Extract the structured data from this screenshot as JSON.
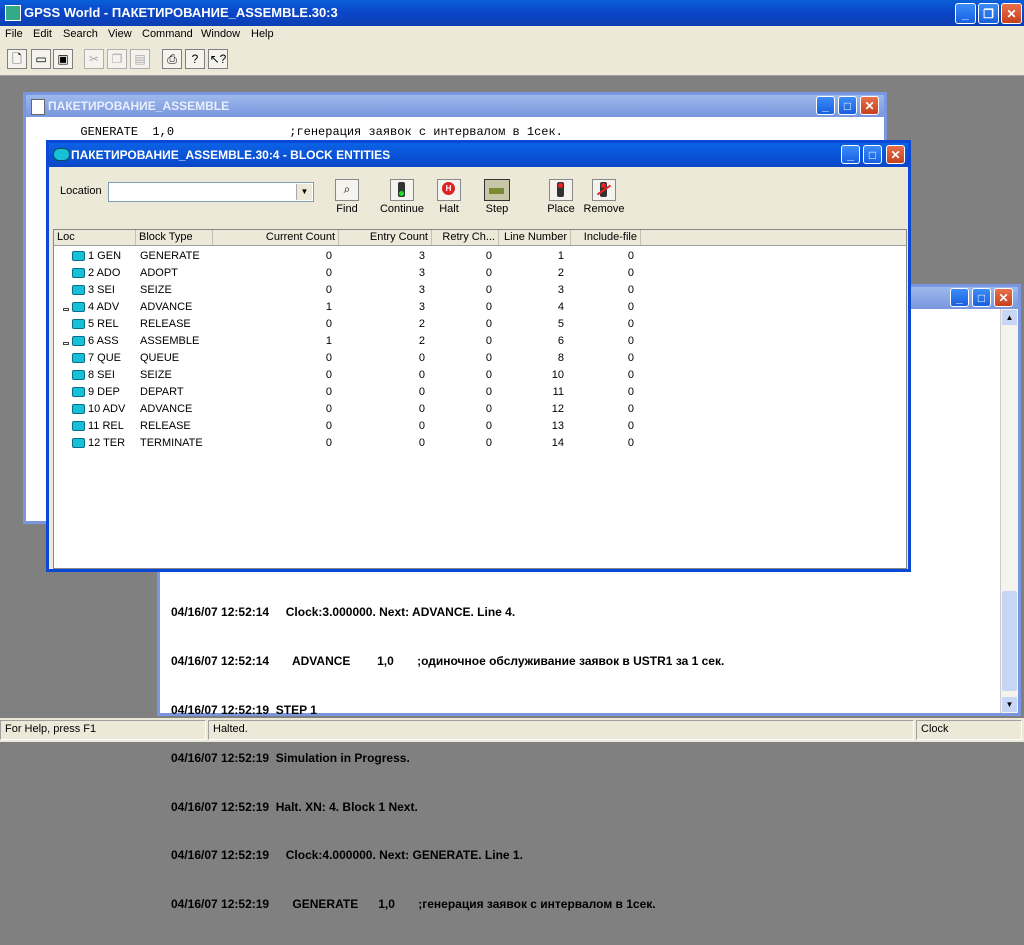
{
  "app": {
    "title": "GPSS World - ПАКЕТИРОВАНИЕ_ASSEMBLE.30:3"
  },
  "menu": [
    "File",
    "Edit",
    "Search",
    "View",
    "Command",
    "Window",
    "Help"
  ],
  "toolbar_icons": [
    "new-icon",
    "open-icon",
    "save-icon",
    "cut-icon",
    "copy-icon",
    "paste-icon",
    "print-icon",
    "help-icon",
    "context-help-icon"
  ],
  "model_window": {
    "title": "ПАКЕТИРОВАНИЕ_ASSEMBLE",
    "line": "       GENERATE  1,0                ;генерация заявок с интервалом в 1сек."
  },
  "log_window": {
    "lines": [
      "04/16/07 12:52:14     Clock:3.000000. Next: ADVANCE. Line 4.",
      "04/16/07 12:52:14       ADVANCE        1,0       ;одиночное обслуживание заявок в USTR1 за 1 сек.",
      "04/16/07 12:52:19  STEP 1",
      "04/16/07 12:52:19  Simulation in Progress.",
      "04/16/07 12:52:19  Halt. XN: 4. Block 1 Next.",
      "04/16/07 12:52:19     Clock:4.000000. Next: GENERATE. Line 1.",
      "04/16/07 12:52:19       GENERATE      1,0       ;генерация заявок с интервалом в 1сек."
    ]
  },
  "block_window": {
    "title": "ПАКЕТИРОВАНИЕ_ASSEMBLE.30:4  -  BLOCK ENTITIES",
    "location_label": "Location",
    "location_value": "",
    "buttons": [
      {
        "label": "Find",
        "icon": "magnifier-icon"
      },
      {
        "label": "Continue",
        "icon": "green-light-icon"
      },
      {
        "label": "Halt",
        "icon": "stop-icon"
      },
      {
        "label": "Step",
        "icon": "step-icon"
      },
      {
        "label": "Place",
        "icon": "red-light-icon"
      },
      {
        "label": "Remove",
        "icon": "remove-icon"
      }
    ],
    "columns": [
      "Loc",
      "Block Type",
      "Current Count",
      "Entry Count",
      "Retry Ch...",
      "Line Number",
      "Include-file"
    ],
    "rows": [
      {
        "loc": "1 GEN",
        "type": "GENERATE",
        "current": "0",
        "entry": "3",
        "retry": "0",
        "line": "1",
        "include": "0"
      },
      {
        "loc": "2 ADO",
        "type": "ADOPT",
        "current": "0",
        "entry": "3",
        "retry": "0",
        "line": "2",
        "include": "0"
      },
      {
        "loc": "3 SEI",
        "type": "SEIZE",
        "current": "0",
        "entry": "3",
        "retry": "0",
        "line": "3",
        "include": "0"
      },
      {
        "loc": "4 ADV",
        "type": "ADVANCE",
        "current": "1",
        "entry": "3",
        "retry": "0",
        "line": "4",
        "include": "0",
        "active": true
      },
      {
        "loc": "5 REL",
        "type": "RELEASE",
        "current": "0",
        "entry": "2",
        "retry": "0",
        "line": "5",
        "include": "0"
      },
      {
        "loc": "6 ASS",
        "type": "ASSEMBLE",
        "current": "1",
        "entry": "2",
        "retry": "0",
        "line": "6",
        "include": "0",
        "active": true
      },
      {
        "loc": "7 QUE",
        "type": "QUEUE",
        "current": "0",
        "entry": "0",
        "retry": "0",
        "line": "8",
        "include": "0"
      },
      {
        "loc": "8 SEI",
        "type": "SEIZE",
        "current": "0",
        "entry": "0",
        "retry": "0",
        "line": "10",
        "include": "0"
      },
      {
        "loc": "9 DEP",
        "type": "DEPART",
        "current": "0",
        "entry": "0",
        "retry": "0",
        "line": "11",
        "include": "0"
      },
      {
        "loc": "10 ADV",
        "type": "ADVANCE",
        "current": "0",
        "entry": "0",
        "retry": "0",
        "line": "12",
        "include": "0"
      },
      {
        "loc": "11 REL",
        "type": "RELEASE",
        "current": "0",
        "entry": "0",
        "retry": "0",
        "line": "13",
        "include": "0"
      },
      {
        "loc": "12 TER",
        "type": "TERMINATE",
        "current": "0",
        "entry": "0",
        "retry": "0",
        "line": "14",
        "include": "0"
      }
    ]
  },
  "status": {
    "help": "For Help, press F1",
    "state": "Halted.",
    "clock": "Clock"
  }
}
